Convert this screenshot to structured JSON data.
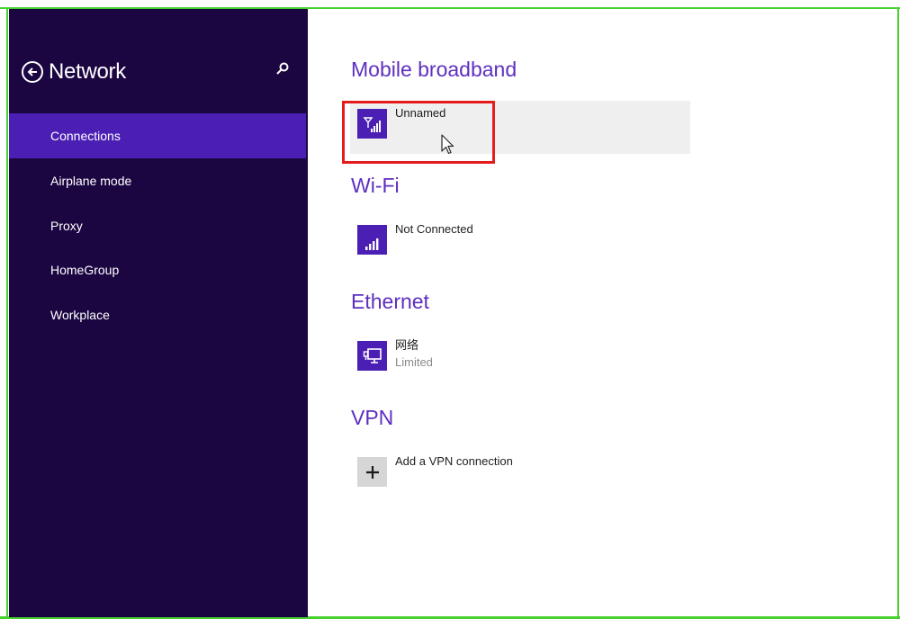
{
  "sidebar": {
    "title": "Network",
    "items": [
      {
        "label": "Connections",
        "active": true
      },
      {
        "label": "Airplane mode",
        "active": false
      },
      {
        "label": "Proxy",
        "active": false
      },
      {
        "label": "HomeGroup",
        "active": false
      },
      {
        "label": "Workplace",
        "active": false
      }
    ]
  },
  "sections": {
    "mobile_broadband": {
      "title": "Mobile broadband",
      "item": {
        "name": "Unnamed",
        "icon": "signal-antenna-icon"
      }
    },
    "wifi": {
      "title": "Wi-Fi",
      "item": {
        "name": "Not Connected",
        "icon": "wifi-signal-icon"
      }
    },
    "ethernet": {
      "title": "Ethernet",
      "item": {
        "name": "网络",
        "status": "Limited",
        "icon": "ethernet-icon"
      }
    },
    "vpn": {
      "title": "VPN",
      "item": {
        "name": "Add a VPN connection",
        "icon": "plus-icon"
      }
    }
  },
  "colors": {
    "sidebar_bg": "#1b0642",
    "accent": "#4b1fb4",
    "section_title": "#5e2fbf",
    "highlight": "#e51c1c",
    "frame": "#47d12f"
  }
}
